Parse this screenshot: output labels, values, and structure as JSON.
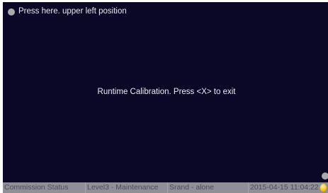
{
  "calibration": {
    "prompt": "Press here. upper left position",
    "message": "Runtime Calibration. Press <X> to exit"
  },
  "status_bar": {
    "commission_status": "Commission Status",
    "user_level": "Level3 - Maintenance",
    "mode": "Srand - alone",
    "datetime": "2015-04-15 11:04:22",
    "indicator_icon": "lightbulb-icon",
    "indicator_color": "#f5c518"
  },
  "colors": {
    "screen_background": "#0b0827",
    "status_bar_background": "#8f8f95",
    "target_dot": "#a9a9ad"
  }
}
